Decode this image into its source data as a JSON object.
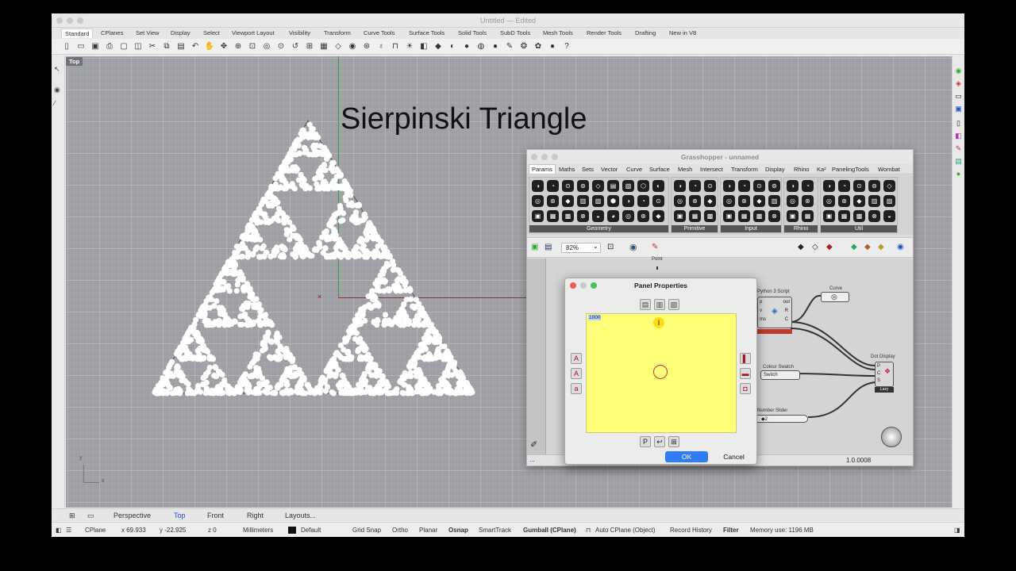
{
  "window": {
    "title": "Untitled",
    "edited": "— Edited"
  },
  "menu_tabs": [
    "Standard",
    "CPlanes",
    "Set View",
    "Display",
    "Select",
    "Viewport Layout",
    "Visibility",
    "Transform",
    "Curve Tools",
    "Surface Tools",
    "Solid Tools",
    "SubD Tools",
    "Mesh Tools",
    "Render Tools",
    "Drafting",
    "New in V8"
  ],
  "viewport": {
    "label": "Top",
    "title": "Sierpinski Triangle",
    "axis_x": "x",
    "axis_y": "y"
  },
  "view_tabs": [
    "Perspective",
    "Top",
    "Front",
    "Right",
    "Layouts..."
  ],
  "status": {
    "cplane": "CPlane",
    "x": "x 69.933",
    "y": "y -22.925",
    "z": "z 0",
    "units": "Millimeters",
    "layer": "Default",
    "items": [
      "Grid Snap",
      "Ortho",
      "Planar",
      "Osnap",
      "SmartTrack",
      "Gumball (CPlane)",
      "Auto CPlane (Object)",
      "Record History",
      "Filter"
    ],
    "memory": "Memory use: 1196 MB"
  },
  "grasshopper": {
    "title": "Grasshopper - unnamed",
    "tabs": [
      "Params",
      "Maths",
      "Sets",
      "Vector",
      "Curve",
      "Surface",
      "Mesh",
      "Intersect",
      "Transform",
      "Display",
      "Rhino",
      "Ka²",
      "PanelingTools",
      "Wombat"
    ],
    "groups": [
      "Geometry",
      "Primitive",
      "Input",
      "Rhino",
      "Util"
    ],
    "zoom": "82%",
    "components": {
      "point": "Point",
      "python": "Python 3 Script",
      "curve": "Curve",
      "colour": "Colour Swatch",
      "switch": "Switch",
      "dot": "Dot Display",
      "slider": "Number Slider",
      "slider_val": "◆2",
      "py_in": [
        "p",
        "v",
        "ms"
      ],
      "py_out": [
        "out",
        "R",
        "C"
      ],
      "dot_in": [
        "P",
        "C",
        "S"
      ],
      "dot_out": "Lazy"
    },
    "footer_left": "...",
    "version": "1.0.0008"
  },
  "panel_properties": {
    "title": "Panel Properties",
    "content": "1000",
    "ok": "OK",
    "cancel": "Cancel"
  }
}
